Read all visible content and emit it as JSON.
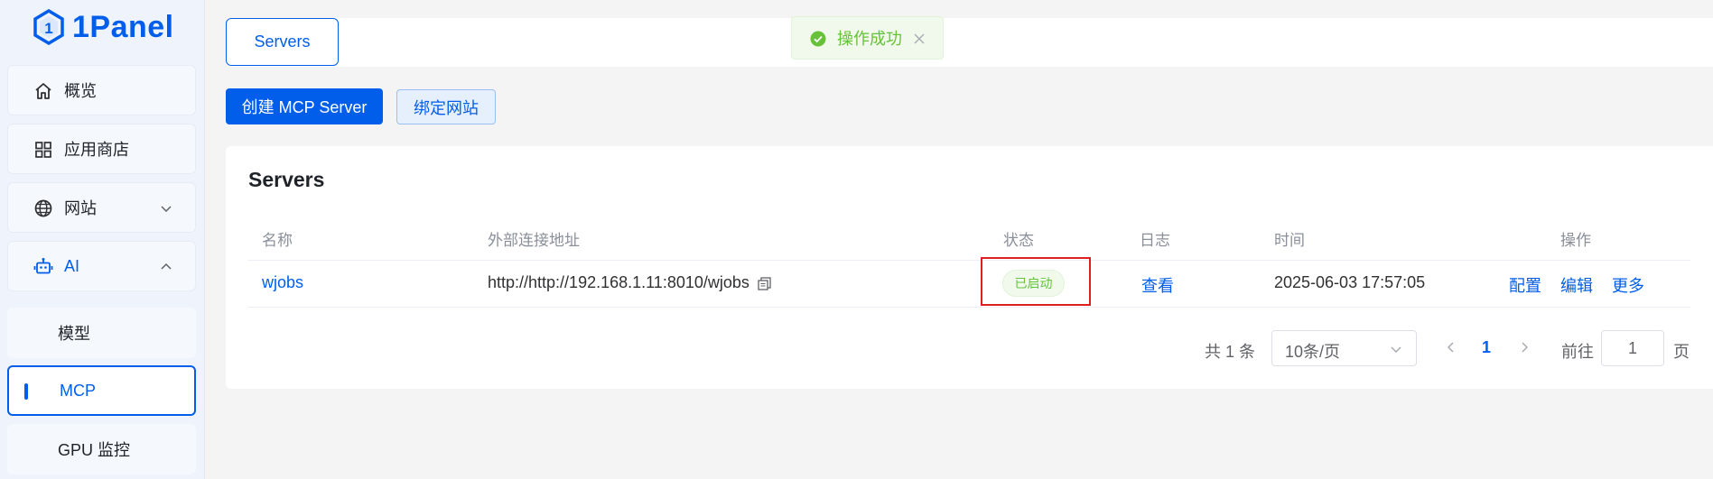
{
  "app": {
    "logo_text": "1Panel"
  },
  "sidebar": {
    "items": [
      {
        "label": "概览",
        "icon": "home-icon"
      },
      {
        "label": "应用商店",
        "icon": "grid-icon"
      },
      {
        "label": "网站",
        "icon": "globe-icon"
      },
      {
        "label": "AI",
        "icon": "robot-icon"
      }
    ],
    "sub_items": [
      {
        "label": "模型"
      },
      {
        "label": "MCP",
        "active": true
      },
      {
        "label": "GPU 监控"
      }
    ]
  },
  "header": {
    "tab_label": "Servers"
  },
  "toast": {
    "message": "操作成功"
  },
  "toolbar": {
    "create_label": "创建 MCP Server",
    "bind_label": "绑定网站"
  },
  "card": {
    "title": "Servers"
  },
  "table": {
    "columns": [
      "名称",
      "外部连接地址",
      "状态",
      "日志",
      "时间",
      "操作"
    ],
    "rows": [
      {
        "name": "wjobs",
        "url": "http://http://192.168.1.11:8010/wjobs",
        "status": "已启动",
        "log": "查看",
        "time": "2025-06-03 17:57:05",
        "actions": [
          "配置",
          "编辑",
          "更多"
        ]
      }
    ]
  },
  "pagination": {
    "total_text": "共 1 条",
    "page_size": "10条/页",
    "current_page": "1",
    "goto_label": "前往",
    "goto_value": "1",
    "page_label": "页"
  },
  "colors": {
    "primary": "#005eeb",
    "success": "#67c23a",
    "highlight_box": "#e02020"
  }
}
